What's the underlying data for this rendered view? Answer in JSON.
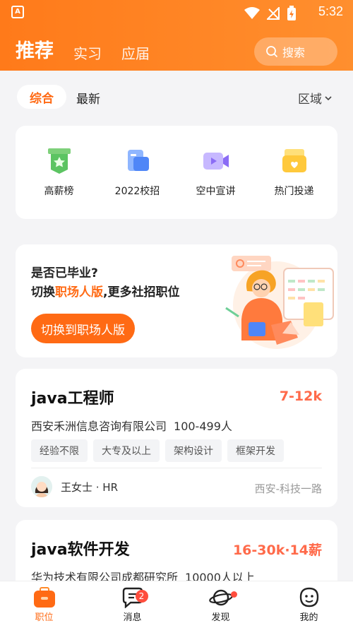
{
  "status_bar": {
    "time": "5:32"
  },
  "header": {
    "tabs": [
      {
        "label": "推荐",
        "active": true
      },
      {
        "label": "实习"
      },
      {
        "label": "应届"
      }
    ],
    "search_placeholder": "搜索"
  },
  "filters": {
    "comprehensive": "综合",
    "latest": "最新",
    "region": "区域"
  },
  "categories": [
    {
      "label": "高薪榜",
      "icon": "ranking-icon"
    },
    {
      "label": "2022校招",
      "icon": "campus-icon"
    },
    {
      "label": "空中宣讲",
      "icon": "video-icon"
    },
    {
      "label": "热门投递",
      "icon": "mailbox-icon"
    }
  ],
  "banner": {
    "line1": "是否已毕业?",
    "line2_prefix": "切换",
    "line2_highlight": "职场人版",
    "line2_suffix": ",更多社招职位",
    "button": "切换到职场人版"
  },
  "jobs": [
    {
      "title": "java工程师",
      "salary": "7-12k",
      "company": "西安禾洲信息咨询有限公司",
      "size": "100-499人",
      "tags": [
        "经验不限",
        "大专及以上",
        "架构设计",
        "框架开发"
      ],
      "recruiter": "王女士 · HR",
      "location": "西安-科技一路"
    },
    {
      "title": "java软件开发",
      "salary": "16-30k·14薪",
      "company": "华为技术有限公司成都研究所",
      "size": "10000人以上"
    }
  ],
  "tabbar": [
    {
      "label": "职位",
      "active": true
    },
    {
      "label": "消息",
      "badge": "2"
    },
    {
      "label": "发现"
    },
    {
      "label": "我的"
    }
  ],
  "colors": {
    "accent": "#ff6a14",
    "salary": "#ff6a4a"
  }
}
